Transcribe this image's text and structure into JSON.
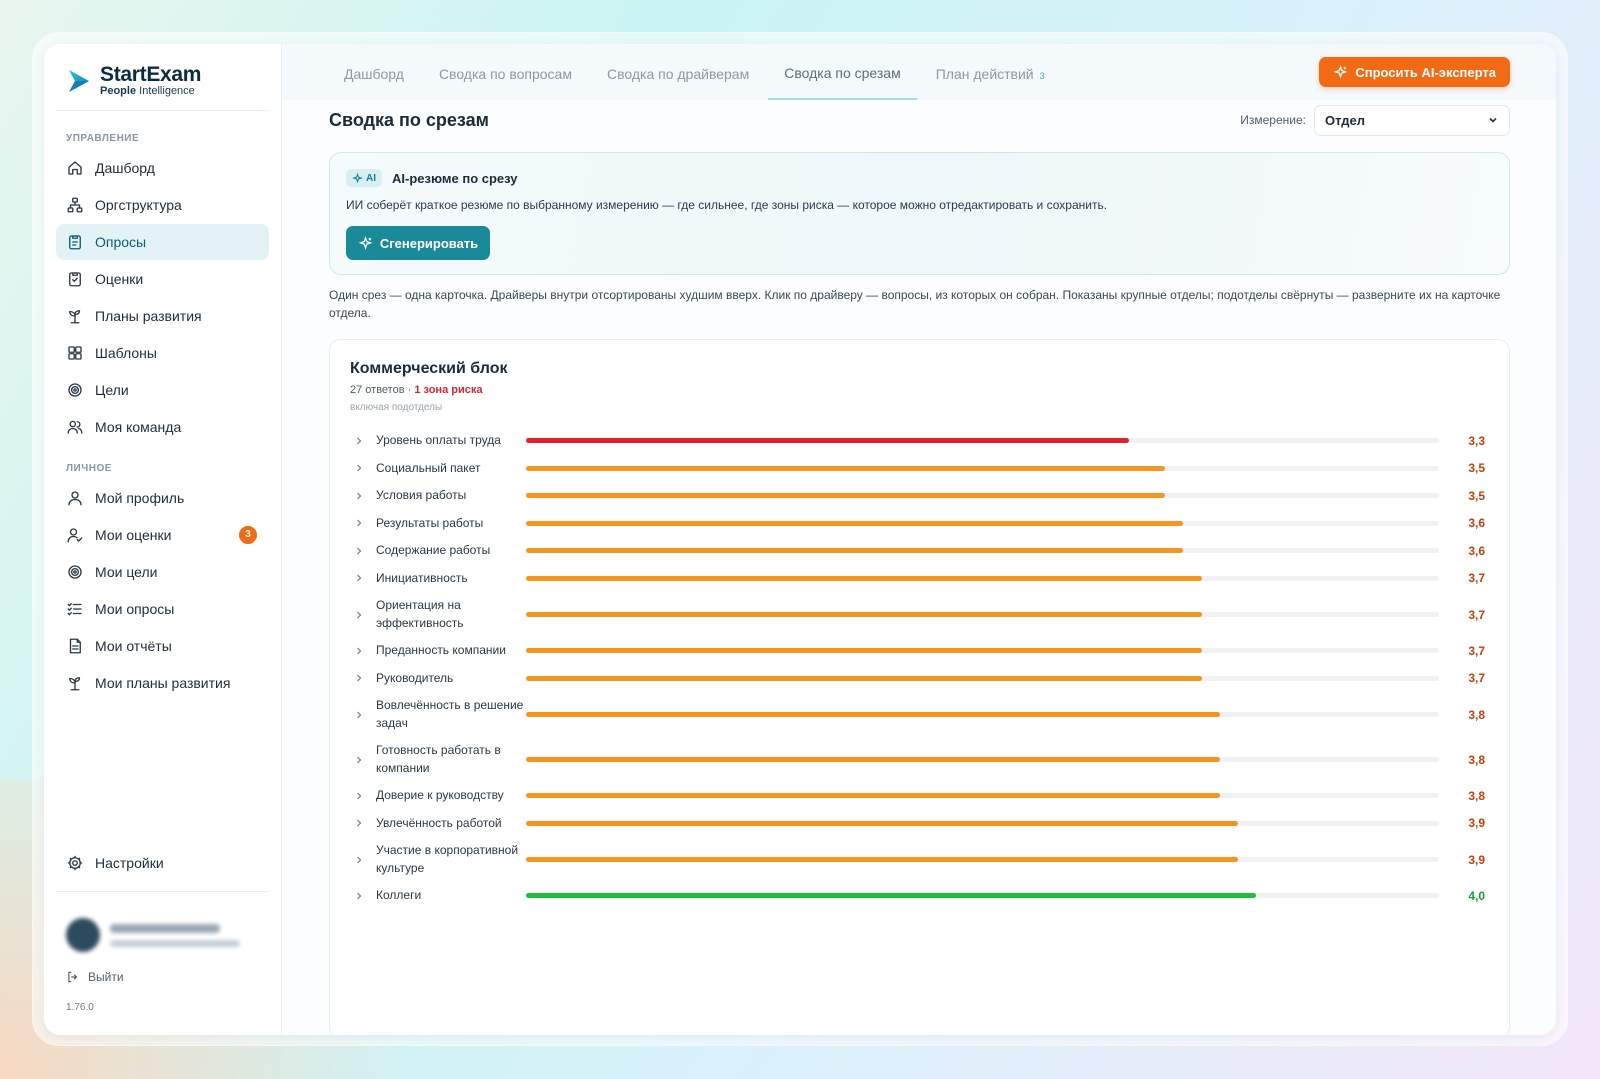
{
  "app": {
    "brand": "StartExam",
    "brand_sub_bold": "People",
    "brand_sub": "Intelligence",
    "version": "1.76.0"
  },
  "sidebar": {
    "section_manage": "УПРАВЛЕНИЕ",
    "section_personal": "ЛИЧНОЕ",
    "manage_items": [
      {
        "label": "Дашборд",
        "icon": "home-icon"
      },
      {
        "label": "Оргструктура",
        "icon": "org-structure-icon"
      },
      {
        "label": "Опросы",
        "icon": "clipboard-icon",
        "active": true
      },
      {
        "label": "Оценки",
        "icon": "clipboard-check-icon"
      },
      {
        "label": "Планы развития",
        "icon": "sprout-icon"
      },
      {
        "label": "Шаблоны",
        "icon": "grid-icon"
      },
      {
        "label": "Цели",
        "icon": "target-icon"
      },
      {
        "label": "Моя команда",
        "icon": "team-icon"
      }
    ],
    "personal_items": [
      {
        "label": "Мой профиль",
        "icon": "user-icon"
      },
      {
        "label": "Мои оценки",
        "icon": "user-check-icon",
        "badge": "3"
      },
      {
        "label": "Мои цели",
        "icon": "target-icon"
      },
      {
        "label": "Мои опросы",
        "icon": "list-check-icon"
      },
      {
        "label": "Мои отчёты",
        "icon": "document-icon"
      },
      {
        "label": "Мои планы развития",
        "icon": "sprout-icon"
      }
    ],
    "settings": "Настройки",
    "logout": "Выйти"
  },
  "topbar": {
    "tabs": [
      {
        "label": "Дашборд"
      },
      {
        "label": "Сводка по вопросам"
      },
      {
        "label": "Сводка по драйверам"
      },
      {
        "label": "Сводка по срезам",
        "active": true
      },
      {
        "label": "План действий",
        "count": "3"
      }
    ],
    "ask_button": "Спросить AI-эксперта"
  },
  "page": {
    "title": "Сводка по срезам",
    "dimension_label": "Измерение:",
    "dimension_value": "Отдел",
    "ai_chip": "AI",
    "ai_title": "AI-резюме по срезу",
    "ai_desc": "ИИ соберёт краткое резюме по выбранному измерению — где сильнее, где зоны риска — которое можно отредактировать и сохранить.",
    "generate_button": "Сгенерировать",
    "hint": "Один срез — одна карточка. Драйверы внутри отсортированы худшим вверх. Клик по драйверу — вопросы, из которых он собран. Показаны крупные отделы; подотделы свёрнуты — разверните их на карточке отдела."
  },
  "slice": {
    "title": "Коммерческий блок",
    "responses": "27 ответов ·",
    "risk": "1 зона риска",
    "note": "включая подотделы"
  },
  "colors": {
    "accent": "#1a8a9a",
    "orange": "#f26a14",
    "risk": "#e5202d",
    "warn": "#f7941d",
    "good": "#1fbf3c",
    "value_warn": "#c2410c",
    "value_good": "#15a02d"
  },
  "chart_data": {
    "type": "bar",
    "orientation": "horizontal",
    "scale_max": 5,
    "categories": [
      "Уровень оплаты труда",
      "Социальный пакет",
      "Условия работы",
      "Результаты работы",
      "Содержание работы",
      "Инициативность",
      "Ориентация на эффективность",
      "Преданность компании",
      "Руководитель",
      "Вовлечённость в решение задач",
      "Готовность работать в компании",
      "Доверие к руководству",
      "Увлечённость работой",
      "Участие в корпоративной культуре",
      "Коллеги"
    ],
    "values": [
      3.3,
      3.5,
      3.5,
      3.6,
      3.6,
      3.7,
      3.7,
      3.7,
      3.7,
      3.8,
      3.8,
      3.8,
      3.9,
      3.9,
      4.0
    ],
    "value_labels": [
      "3,3",
      "3,5",
      "3,5",
      "3,6",
      "3,6",
      "3,7",
      "3,7",
      "3,7",
      "3,7",
      "3,8",
      "3,8",
      "3,8",
      "3,9",
      "3,9",
      "4,0"
    ],
    "status": [
      "risk",
      "warn",
      "warn",
      "warn",
      "warn",
      "warn",
      "warn",
      "warn",
      "warn",
      "warn",
      "warn",
      "warn",
      "warn",
      "warn",
      "good"
    ]
  }
}
